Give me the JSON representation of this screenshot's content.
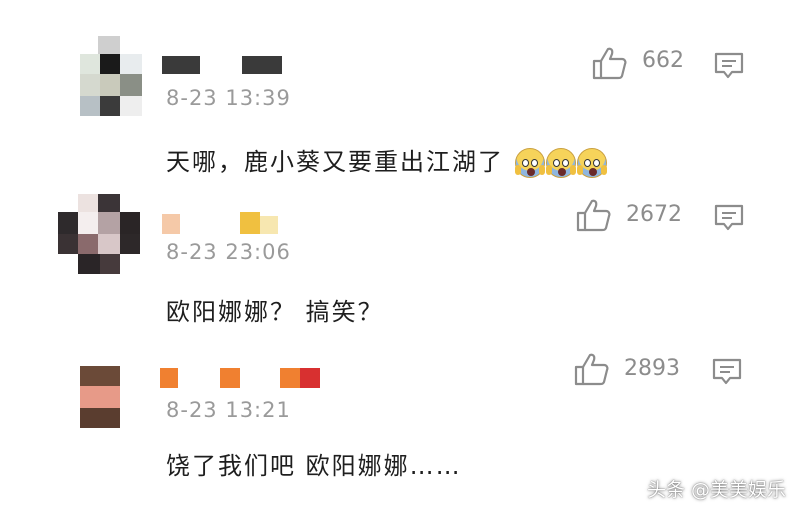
{
  "comments": [
    {
      "timestamp": "8-23 13:39",
      "text": "天哪，鹿小葵又要重出江湖了",
      "emoji": "face-screaming-in-fear",
      "like_count": "662",
      "name_colors": [
        "#3a3a3a",
        "#3a3a3a"
      ]
    },
    {
      "timestamp": "8-23 23:06",
      "text": "欧阳娜娜？ 搞笑？",
      "like_count": "2672",
      "name_colors": [
        "#f5c9a8",
        "#f0c040"
      ]
    },
    {
      "timestamp": "8-23 13:21",
      "text": "饶了我们吧 欧阳娜娜……",
      "like_count": "2893",
      "name_colors": [
        "#f08030",
        "#f08030",
        "#f08030",
        "#d83030"
      ]
    }
  ],
  "watermark": "头条 @美美娱乐",
  "colors": {
    "text": "#1e1e1e",
    "meta": "#9a9a9a",
    "icon": "#8c8c8c"
  }
}
